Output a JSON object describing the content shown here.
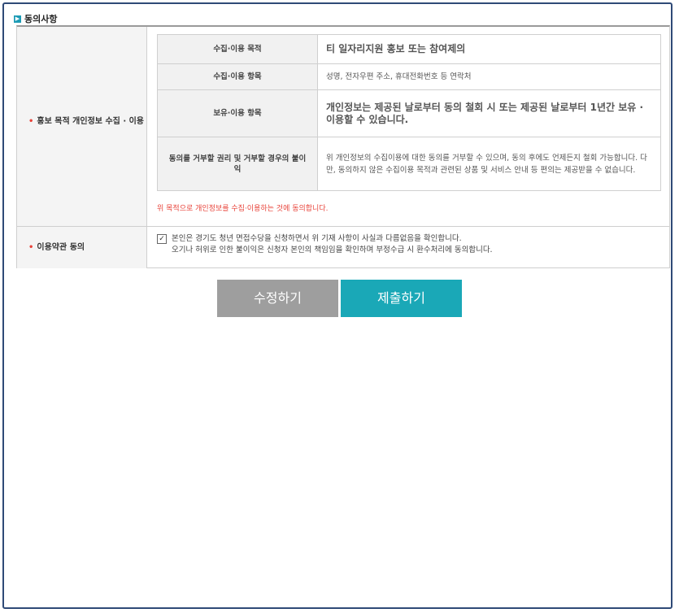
{
  "section": {
    "icon": "chevron-right-icon",
    "title": "동의사항"
  },
  "privacy": {
    "label": "홍보 목적 개인정보 수집 · 이용",
    "rows": [
      {
        "header": "수집·이용 목적",
        "value": "티 일자리지원 홍보 또는 참여제의",
        "style": "red-big"
      },
      {
        "header": "수집·이용 항목",
        "value": "성명, 전자우편 주소, 휴대전화번호 등 연락처",
        "style": "normal"
      },
      {
        "header": "보유·이용 항목",
        "value": "개인정보는 제공된 날로부터 동의 철회 시 또는 제공된 날로부터 1년간 보유 · 이용할 수 있습니다.",
        "style": "red-big"
      },
      {
        "header": "동의를 거부할 권리 및 거부할 경우의 불이익",
        "value": "위 개인정보의 수집이용에 대한 동의를 거부할 수 있으며, 동의 후에도 언제든지 철회 가능합니다. 다만, 동의하지 않은 수집이용 목적과 관련된 상품 및 서비스 안내 등 편의는 제공받을 수 없습니다.",
        "style": "normal"
      }
    ],
    "consent_note": "위 목적으로 개인정보를 수집·이용하는 것에 동의합니다."
  },
  "terms": {
    "label": "이용약관 동의",
    "checkbox_checked": true,
    "line1": "본인은 경기도 청년 면접수당을 신청하면서 위 기재 사항이 사실과 다름없음을 확인합니다.",
    "line2": "오기나 허위로 인한 불이익은 신청자 본인의 책임임을 확인하며 부정수급 시 환수처리에 동의합니다."
  },
  "buttons": {
    "edit": "수정하기",
    "submit": "제출하기"
  },
  "colors": {
    "accent": "#1aa8b7",
    "red": "#e8433a",
    "border": "#2f4a77",
    "edit_button": "#9e9e9e"
  }
}
